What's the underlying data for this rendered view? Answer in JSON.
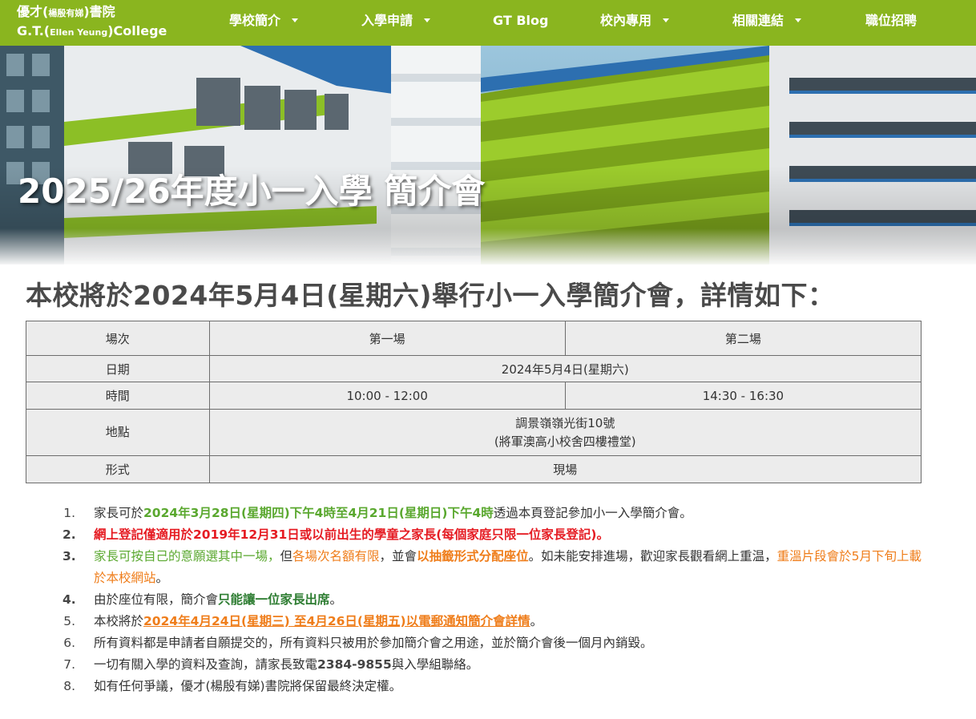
{
  "nav": {
    "logo_line1_a": "優才(",
    "logo_line1_small": "楊殷有娣",
    "logo_line1_b": ")書院",
    "logo_line2_a": "G.T.(",
    "logo_line2_small": "Ellen Yeung",
    "logo_line2_b": ")College",
    "items": [
      {
        "label": "學校簡介",
        "has_dropdown": true
      },
      {
        "label": "入學申請",
        "has_dropdown": true
      },
      {
        "label": "GT Blog",
        "has_dropdown": false
      },
      {
        "label": "校內專用",
        "has_dropdown": true
      },
      {
        "label": "相關連結",
        "has_dropdown": true
      },
      {
        "label": "職位招聘",
        "has_dropdown": false
      }
    ],
    "bg_color": "#8ab51f"
  },
  "hero": {
    "title": "2025/26年度小一入學 簡介會"
  },
  "headline": {
    "a": "本校將於",
    "b": "2024年5月4日(星期六)",
    "c": "舉行小一入學簡介會，詳情如下："
  },
  "table": {
    "header": {
      "label": "場次",
      "s1": "第一場",
      "s2": "第二場"
    },
    "date": {
      "label": "日期",
      "value": "2024年5月4日(星期六)"
    },
    "time": {
      "label": "時間",
      "s1": "10:00 - 12:00",
      "s2": "14:30 - 16:30"
    },
    "venue": {
      "label": "地點",
      "line1": "調景嶺嶺光街10號",
      "line2": "(將軍澳高小校舍四樓禮堂)"
    },
    "format": {
      "label": "形式",
      "value": "現場"
    }
  },
  "notes": {
    "n1": {
      "num": "1.",
      "a": "家長可於",
      "b": "2024年3月28日(星期四)下午4時至4月21日(星期日)下午4時",
      "c": "透過本頁登記參加小一入學簡介會。"
    },
    "n2": {
      "num": "2.",
      "a": "網上登記僅適用於2019年12月31日或以前出生的學童之家長(每個家庭只限一位家長登記)。"
    },
    "n3": {
      "num": "3.",
      "a": "家長可按自己的意願選其中一場，",
      "b": "但",
      "c": "各場次名額有限",
      "d": "，並會",
      "e": "以抽籤形式分配座位",
      "f": "。如未能安排進場，歡迎家長觀看網上重温，",
      "g": "重溫片段會於5月下旬上載於本校網站",
      "h": "。"
    },
    "n4": {
      "num": "4.",
      "a": "由於座位有限，簡介會",
      "b": "只能讓一位家長出席",
      "c": "。"
    },
    "n5": {
      "num": "5.",
      "a": "本校將於",
      "b": "2024年4月24日(星期三) 至4月26日(星期五)以電郵通知簡介會詳情",
      "c": "。"
    },
    "n6": {
      "num": "6.",
      "a": "所有資料都是申請者自願提交的，所有資料只被用於參加簡介會之用途，並於簡介會後一個月內銷毀。"
    },
    "n7": {
      "num": "7.",
      "a": "一切有關入學的資料及查詢，請家長致電",
      "b": "2384-9855",
      "c": "與入學組聯絡。"
    },
    "n8": {
      "num": "8.",
      "a": "如有任何爭議，優才(楊殷有娣)書院將保留最終決定權。"
    }
  },
  "colors": {
    "green": "#5aa82f",
    "dark_green": "#2e7d32",
    "orange": "#ef7d1a",
    "red": "#e51c23"
  }
}
